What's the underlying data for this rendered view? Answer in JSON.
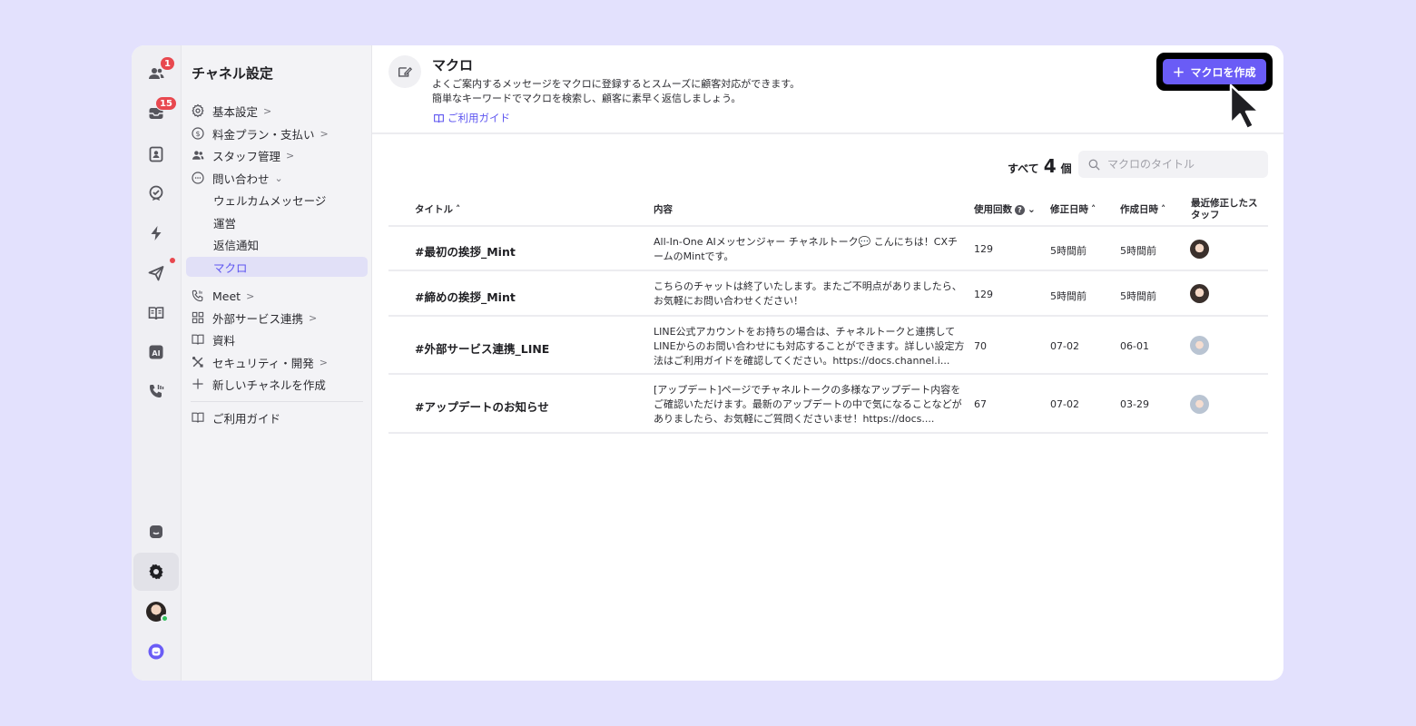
{
  "rail": {
    "badges": {
      "contacts": "1",
      "inbox": "15"
    }
  },
  "sidebar": {
    "title": "チャネル設定",
    "items": {
      "basic": "基本設定",
      "billing": "料金プラン・支払い",
      "staff": "スタッフ管理",
      "inquiry": "問い合わせ",
      "welcome": "ウェルカムメッセージ",
      "operation": "運営",
      "reply_notice": "返信通知",
      "macro": "マクロ",
      "meet": "Meet",
      "integrations": "外部サービス連携",
      "docs": "資料",
      "security": "セキュリティ・開発",
      "new_channel": "新しいチャネルを作成",
      "guide": "ご利用ガイド"
    }
  },
  "header": {
    "title": "マクロ",
    "desc_line1": "よくご案内するメッセージをマクロに登録するとスムーズに顧客対応ができます。",
    "desc_line2": "簡単なキーワードでマクロを検索し、顧客に素早く返信しましょう。",
    "guide_link": "ご利用ガイド",
    "create_button": "マクロを作成"
  },
  "toolbar": {
    "count_prefix": "すべて",
    "count_value": "4",
    "count_suffix": "個",
    "search_placeholder": "マクロのタイトル"
  },
  "table": {
    "columns": {
      "title": "タイトル",
      "content": "内容",
      "usage": "使用回数",
      "modified": "修正日時",
      "created": "作成日時",
      "staff": "最近修正したスタッフ"
    },
    "rows": [
      {
        "title": "#最初の挨拶_Mint",
        "content": "All-In-One AIメッセンジャー チャネルトーク💬 こんにちは！CXチームのMintです。",
        "usage": "129",
        "modified": "5時間前",
        "created": "5時間前",
        "avatar": "dark"
      },
      {
        "title": "#締めの挨拶_Mint",
        "content": "こちらのチャットは終了いたします。またご不明点がありましたら、お気軽にお問い合わせください！",
        "usage": "129",
        "modified": "5時間前",
        "created": "5時間前",
        "avatar": "dark"
      },
      {
        "title": "#外部サービス連携_LINE",
        "content": "LINE公式アカウントをお持ちの場合は、チャネルトークと連携してLINEからのお問い合わせにも対応することができます。詳しい設定方法はご利用ガイドを確認してください。https://docs.channel.i...",
        "usage": "70",
        "modified": "07-02",
        "created": "06-01",
        "avatar": "light"
      },
      {
        "title": "#アップデートのお知らせ",
        "content": "[アップデート]ページでチャネルトークの多様なアップデート内容をご確認いただけます。最新のアップデートの中で気になることなどがありましたら、お気軽にご質問くださいませ！https://docs....",
        "usage": "67",
        "modified": "07-02",
        "created": "03-29",
        "avatar": "light"
      }
    ]
  },
  "colors": {
    "accent": "#6a5cf6",
    "background": "#e3e1fd",
    "badge": "#e8484f"
  }
}
